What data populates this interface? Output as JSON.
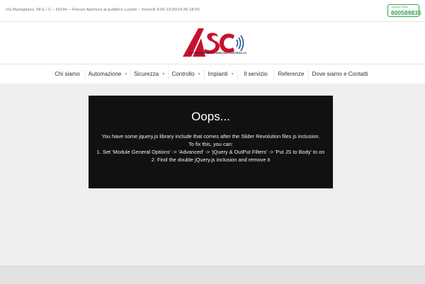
{
  "topbar": {
    "address": "Via Mariagliano, 58 E / C – 50144 – Firenze Apertura al pubblico Lunedì – Venerdì 9:00-13:00/14:30-18:00",
    "callbox_label": "Numero Verde",
    "callbox_number": "800589835",
    "accent_color": "#2ea44f"
  },
  "logo": {
    "letters": "ASC",
    "tagline": "AUTOMAZIONE SICUREZZA CONTROLLO",
    "brand_red": "#c8102e",
    "brand_blue": "#1f4e9c"
  },
  "nav": {
    "items": [
      {
        "label": "Chi siamo"
      },
      {
        "label": "Automazione",
        "has_caret": true
      },
      {
        "label": "Sicurezza",
        "has_caret": true
      },
      {
        "label": "Controllo",
        "has_caret": true
      },
      {
        "label": "Impianti",
        "has_caret": true
      },
      {
        "label": "Il servizio"
      },
      {
        "label": "Referenze"
      },
      {
        "label": "Dove siamo e Contatti"
      }
    ],
    "caret_glyph": "▼"
  },
  "error": {
    "title": "Oops...",
    "line1": "You have some jquery.js library include that comes after the Slider Revolution files js inclusion.",
    "line2": "To fix this, you can:",
    "line3": "1. Set 'Module General Options' -> 'Advanced' -> 'jQuery & OutPut Filters' -> 'Put JS to Body' to on",
    "line4": "2. Find the double jQuery.js inclusion and remove it"
  }
}
